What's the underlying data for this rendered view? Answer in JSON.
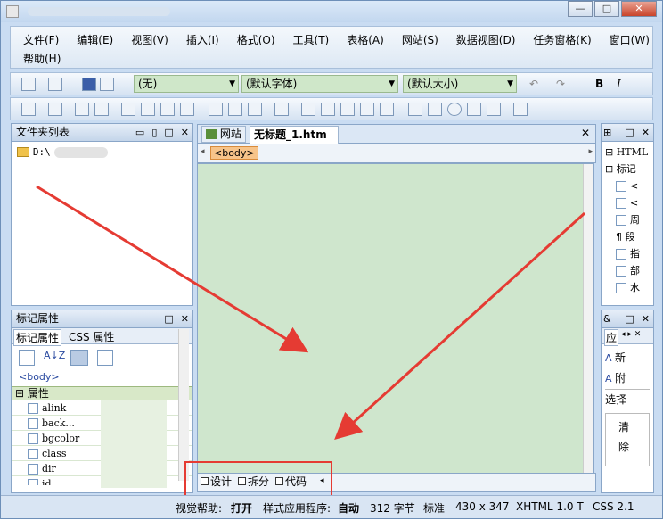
{
  "menu": {
    "row1": [
      "文件(F)",
      "编辑(E)",
      "视图(V)",
      "插入(I)",
      "格式(O)",
      "工具(T)",
      "表格(A)",
      "网站(S)",
      "数据视图(D)",
      "任务窗格(K)",
      "窗口(W)"
    ],
    "row2": [
      "帮助(H)"
    ]
  },
  "toolbar": {
    "style_combo": "(无)",
    "font_combo": "(默认字体)",
    "size_combo": "(默认大小)",
    "bold_label": "B",
    "italic_label": "I"
  },
  "folder_panel": {
    "title": "文件夹列表",
    "root_item": "D:\\"
  },
  "tag_props_panel": {
    "title": "标记属性",
    "tab1": "标记属性",
    "tab2": "CSS 属性",
    "tag_label": "<body>",
    "section": "属性",
    "attributes": [
      "alink",
      "back...",
      "bgcolor",
      "class",
      "dir",
      "id"
    ]
  },
  "editor": {
    "tab_website": "网站",
    "tab_file": "无标题_1.htm",
    "body_tag": "<body>",
    "view_design": "设计",
    "view_split": "拆分",
    "view_code": "代码"
  },
  "right_panel": {
    "item_html": "HTML",
    "item_tags": "标记",
    "entries": [
      "<",
      "<",
      "周",
      "段",
      "指",
      "部",
      "水"
    ],
    "apply_label": "应",
    "new_label": "新",
    "attach_label": "附",
    "select_label": "选择",
    "clear_label": "清除"
  },
  "status_bar": {
    "visual_aid_label": "视觉帮助:",
    "visual_aid_value": "打开",
    "style_app_label": "样式应用程序:",
    "style_app_value": "自动",
    "size": "312 字节",
    "mode": "标准",
    "dimensions": "430 x 347",
    "doctype": "XHTML 1.0 T",
    "css": "CSS 2.1"
  },
  "colors": {
    "editor_bg": "#cfe6cd",
    "arrow": "#e53b33",
    "chrome": "#c9dcf2"
  }
}
